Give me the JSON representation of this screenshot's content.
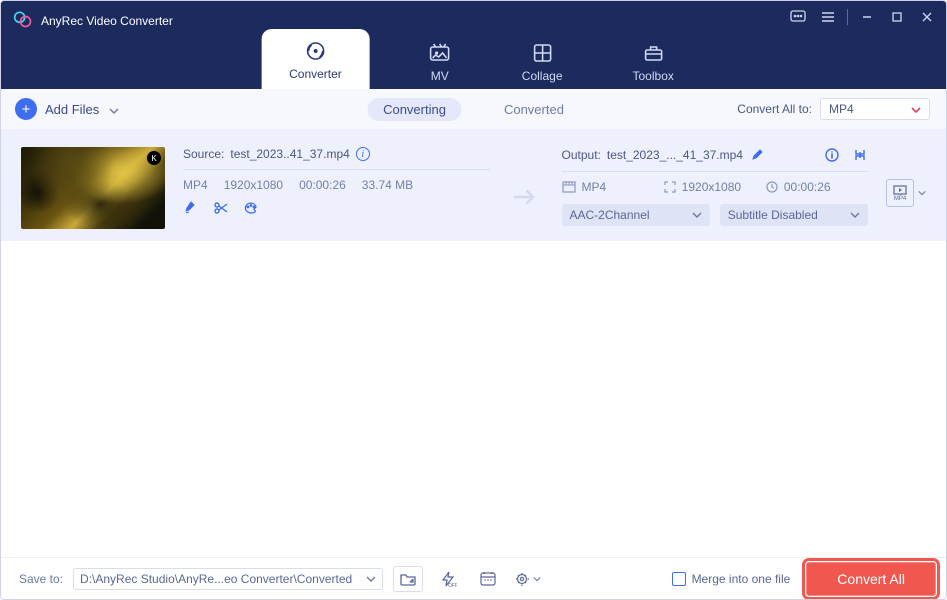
{
  "app": {
    "title": "AnyRec Video Converter"
  },
  "nav": {
    "tabs": [
      {
        "label": "Converter",
        "active": true
      },
      {
        "label": "MV"
      },
      {
        "label": "Collage"
      },
      {
        "label": "Toolbox"
      }
    ]
  },
  "toolbar": {
    "add_files": "Add Files",
    "status_tabs": {
      "converting": "Converting",
      "converted": "Converted"
    },
    "convert_all_to_label": "Convert All to:",
    "convert_all_to_value": "MP4"
  },
  "file": {
    "source_label": "Source:",
    "source_name": "test_2023..41_37.mp4",
    "info": {
      "format": "MP4",
      "resolution": "1920x1080",
      "duration": "00:00:26",
      "size": "33.74 MB"
    },
    "output_label": "Output:",
    "output_name": "test_2023_..._41_37.mp4",
    "out_info": {
      "format": "MP4",
      "resolution": "1920x1080",
      "duration": "00:00:26"
    },
    "audio_sel": "AAC-2Channel",
    "subtitle_sel": "Subtitle Disabled",
    "format_badge": "MP4"
  },
  "footer": {
    "save_to_label": "Save to:",
    "path": "D:\\AnyRec Studio\\AnyRe...eo Converter\\Converted",
    "merge_label": "Merge into one file",
    "convert_all": "Convert All"
  }
}
